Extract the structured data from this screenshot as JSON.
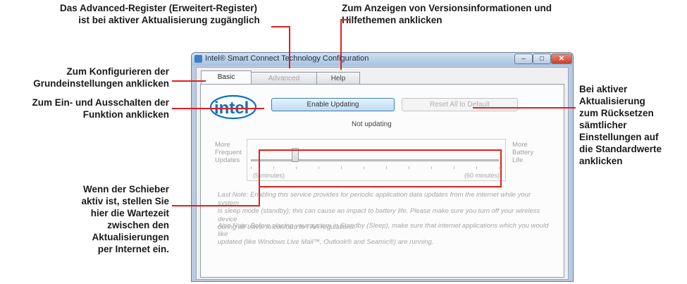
{
  "annotations": {
    "advanced_tab_line1": "Das Advanced-Register (Erweitert-Register)",
    "advanced_tab_line2": "ist bei aktiver Aktualisierung zugänglich",
    "help_tab_line1": "Zum Anzeigen von Versionsinformationen und",
    "help_tab_line2": "Hilfethemen anklicken",
    "basic_tab_line1": "Zum Konfigurieren der",
    "basic_tab_line2": "Grundeinstellungen anklicken",
    "enable_line1": "Zum Ein- und Ausschalten der",
    "enable_line2": "Funktion anklicken",
    "reset_lines": [
      "Bei aktiver",
      "Aktualisierung",
      "zum Rücksetzen",
      "sämtlicher",
      "Einstellungen auf",
      "die Standardwerte",
      "anklicken"
    ],
    "slider_lines": [
      "Wenn der Schieber",
      "aktiv ist, stellen Sie",
      "hier die Wartezeit",
      "zwischen den",
      "Aktualisierungen",
      "per Internet ein."
    ]
  },
  "window": {
    "title": "Intel® Smart Connect Technology Configuration",
    "min_glyph": "–",
    "max_glyph": "□",
    "close_glyph": "✕"
  },
  "tabs": {
    "basic": "Basic",
    "advanced": "Advanced",
    "help": "Help"
  },
  "logo_text": "intel",
  "buttons": {
    "enable": "Enable Updating",
    "reset": "Reset All to Default"
  },
  "status": "Not updating",
  "slider": {
    "left_label_lines": [
      "More",
      "Frequent",
      "Updates"
    ],
    "right_label_lines": [
      "More",
      "Battery",
      "Life"
    ],
    "min_label": "(5 minutes)",
    "max_label": "(60 minutes)",
    "position_fraction": 0.18
  },
  "notes": {
    "note1_lines": [
      "Last Note: Enabling this service provides for periodic application data updates from the internet while your system",
      "is sleep mode (standby); this can cause an impact to battery life. Please make sure you turn off your wireless device",
      "during air travel to conform to FAA regulations."
    ],
    "note2_lines": [
      "Also Note: Before placing your system in Standby (Sleep), make sure that internet applications which you would like",
      "updated (like Windows Live Mail™, Outlook® and Seamic®) are running."
    ]
  },
  "colors": {
    "annotation_line": "#e0201d",
    "intel_blue": "#0a71c5"
  }
}
